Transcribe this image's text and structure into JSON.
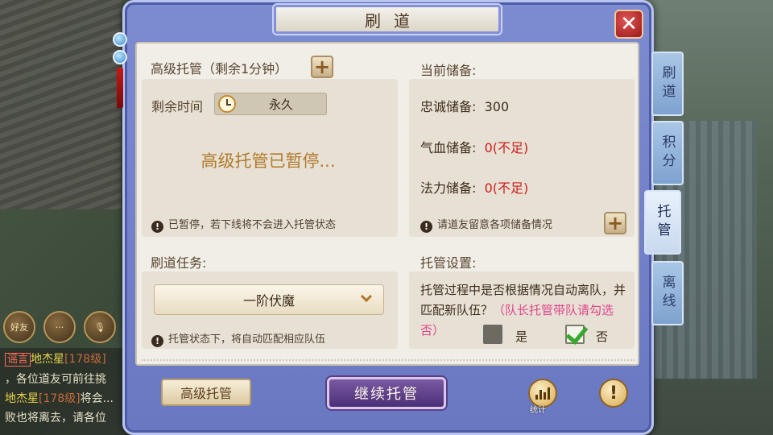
{
  "window": {
    "title": "刷道",
    "close_symbol": "✕"
  },
  "chat": {
    "friend_label": "好友",
    "lines": [
      {
        "tag": "谣言",
        "name": "地杰星",
        "level": "[178级]",
        "text": ""
      },
      {
        "text": "，各位道友可前往挑"
      },
      {
        "name": "地杰星",
        "level": "[178级]",
        "text": "将会..."
      },
      {
        "text": "败也将离去，请各位"
      }
    ]
  },
  "auto_manage": {
    "title": "高级托管（剩余1分钟）",
    "remaining_label": "剩余时间",
    "remaining_value": "永久",
    "paused_text": "高级托管已暂停...",
    "paused_note": "已暂停，若下线将不会进入托管状态"
  },
  "reserves": {
    "title": "当前储备:",
    "loyalty_label": "忠诚储备:",
    "loyalty_value": "300",
    "hp_label": "气血储备:",
    "hp_value": "0(不足)",
    "mp_label": "法力储备:",
    "mp_value": "0(不足)",
    "note": "请道友留意各项储备情况"
  },
  "task": {
    "title": "刷道任务:",
    "selected": "一阶伏魔",
    "note": "托管状态下，将自动匹配相应队伍"
  },
  "settings": {
    "title": "托管设置:",
    "question": "托管过程中是否根据情况自动离队，并匹配新队伍？",
    "hint": "（队长托管带队请勾选否）",
    "yes_label": "是",
    "no_label": "否",
    "yes_checked": false,
    "no_checked": true
  },
  "tabs": [
    {
      "label": "刷道",
      "active": false
    },
    {
      "label": "积分",
      "active": false
    },
    {
      "label": "托管",
      "active": true
    },
    {
      "label": "离线",
      "active": false
    }
  ],
  "footer": {
    "advanced_button": "高级托管",
    "continue_button": "继续托管",
    "stats_label": "统计",
    "info_symbol": "!"
  },
  "colors": {
    "frame": "#7d8bd0",
    "panel": "#f1eee7",
    "warning_red": "#cf1a1a",
    "hint_pink": "#e0458a",
    "paused_gold": "#b27a2c",
    "primary_button": "#5a3f84"
  }
}
